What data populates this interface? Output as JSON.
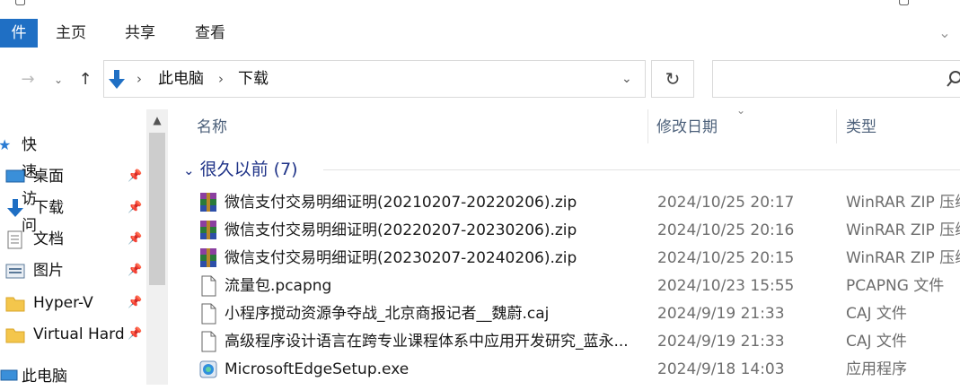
{
  "ribbon": {
    "file_tab": "件",
    "tabs": [
      "主页",
      "共享",
      "查看"
    ]
  },
  "address": {
    "crumbs": [
      "此电脑",
      "下载"
    ]
  },
  "nav": {
    "quick_access": "快速访问",
    "items": [
      {
        "label": "桌面",
        "icon": "desktop-icon",
        "pinned": true
      },
      {
        "label": "下载",
        "icon": "download-icon",
        "pinned": true
      },
      {
        "label": "文档",
        "icon": "document-icon",
        "pinned": true
      },
      {
        "label": "图片",
        "icon": "picture-icon",
        "pinned": true
      },
      {
        "label": "Hyper-V",
        "icon": "folder-icon",
        "pinned": true
      },
      {
        "label": "Virtual Hard",
        "icon": "folder-icon",
        "pinned": true
      }
    ],
    "this_pc": "此电脑"
  },
  "columns": {
    "name": "名称",
    "modified": "修改日期",
    "type": "类型"
  },
  "group": {
    "label": "很久以前 (7)"
  },
  "files": [
    {
      "name": "微信支付交易明细证明(20210207-20220206).zip",
      "date": "2024/10/25 20:17",
      "type": "WinRAR ZIP 压缩",
      "icon": "winrar-icon"
    },
    {
      "name": "微信支付交易明细证明(20220207-20230206).zip",
      "date": "2024/10/25 20:16",
      "type": "WinRAR ZIP 压缩",
      "icon": "winrar-icon"
    },
    {
      "name": "微信支付交易明细证明(20230207-20240206).zip",
      "date": "2024/10/25 20:15",
      "type": "WinRAR ZIP 压缩",
      "icon": "winrar-icon"
    },
    {
      "name": "流量包.pcapng",
      "date": "2024/10/23 15:55",
      "type": "PCAPNG 文件",
      "icon": "file-icon"
    },
    {
      "name": "小程序搅动资源争夺战_北京商报记者__魏蔚.caj",
      "date": "2024/9/19 21:33",
      "type": "CAJ 文件",
      "icon": "file-icon"
    },
    {
      "name": "高级程序设计语言在跨专业课程体系中应用开发研究_蓝永...",
      "date": "2024/9/19 21:33",
      "type": "CAJ 文件",
      "icon": "file-icon"
    },
    {
      "name": "MicrosoftEdgeSetup.exe",
      "date": "2024/9/18 14:03",
      "type": "应用程序",
      "icon": "installer-icon"
    }
  ],
  "colors": {
    "accent": "#1f6fc4",
    "group_header": "#1e3287",
    "column_header": "#4c607a",
    "secondary_text": "#6d6d6d"
  }
}
